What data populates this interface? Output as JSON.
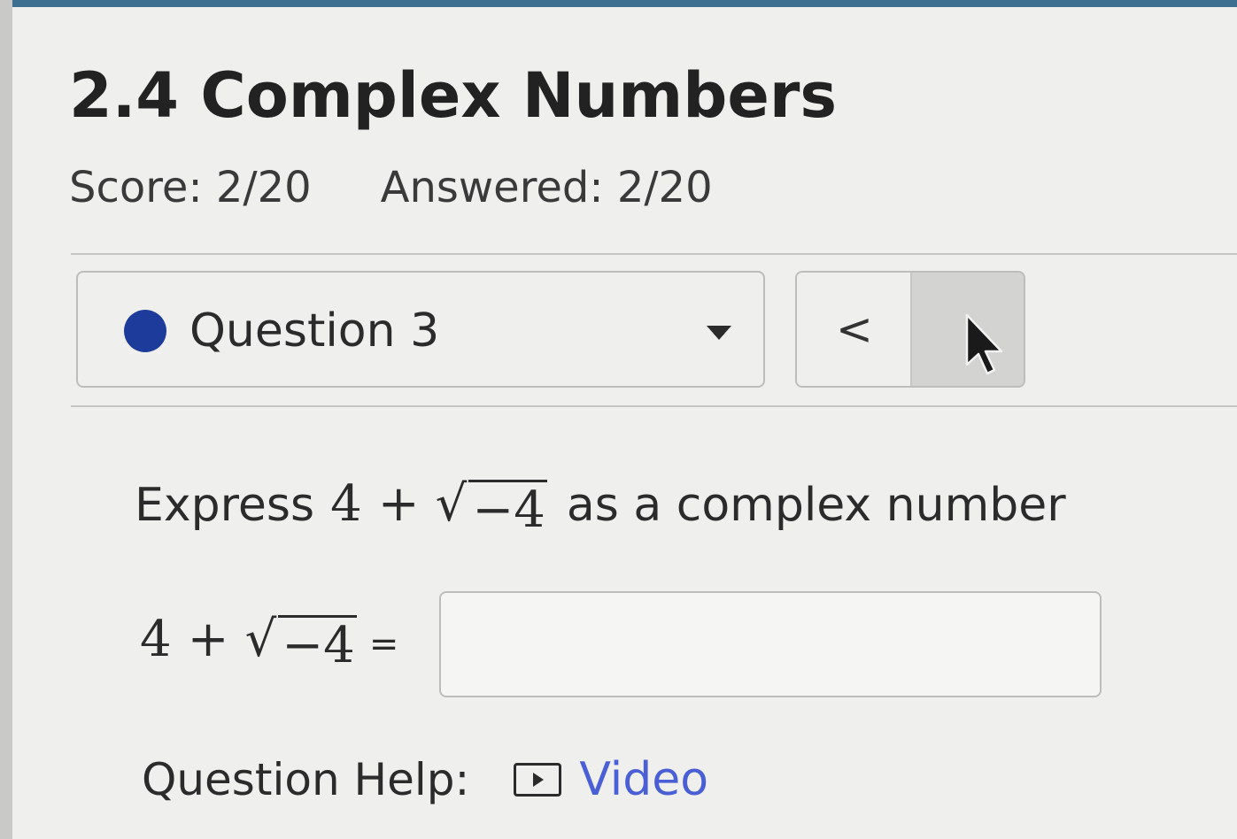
{
  "assignment": {
    "title": "2.4 Complex Numbers",
    "score": "Score: 2/20",
    "answered": "Answered: 2/20"
  },
  "question_nav": {
    "selected": "Question 3",
    "status_color": "#1d3b9a",
    "prev_label": "<"
  },
  "question": {
    "prompt_prefix": "Express",
    "expr_term": "4",
    "expr_op": "+",
    "expr_radicand": "−4",
    "prompt_suffix": "as a complex number",
    "equals": "=",
    "answer_value": ""
  },
  "help": {
    "label": "Question Help:",
    "video_label": "Video",
    "link_color": "#4a5fd6"
  }
}
